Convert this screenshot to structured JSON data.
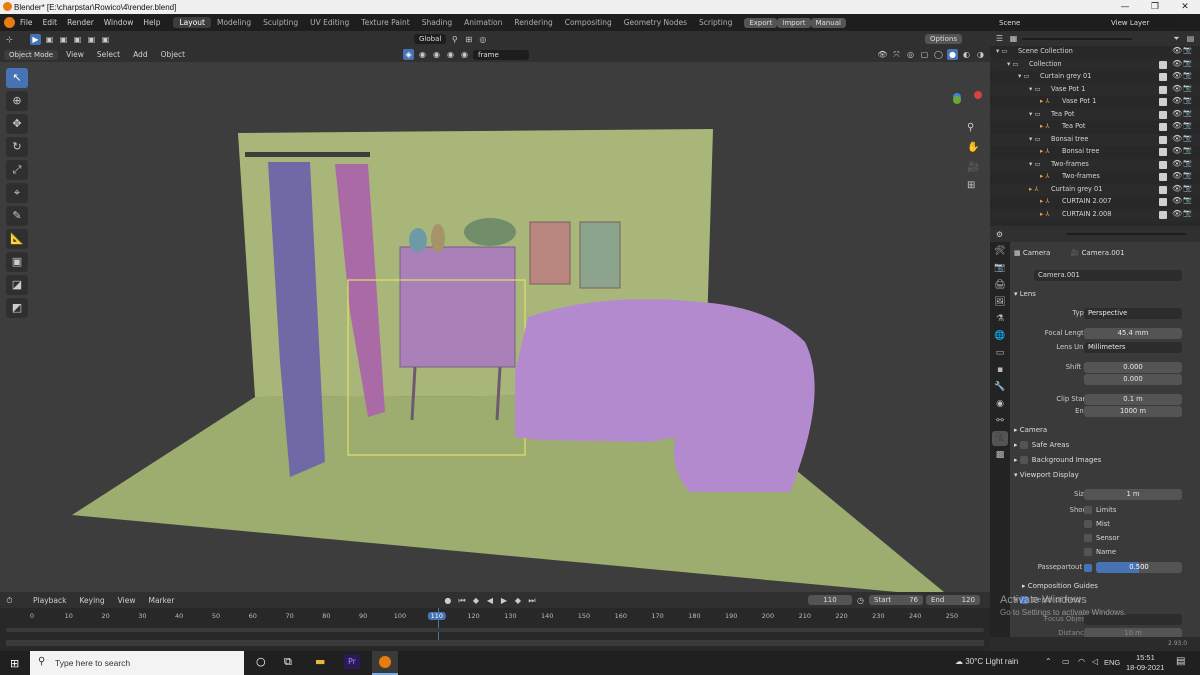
{
  "window": {
    "title": "Blender* [E:\\charpstar\\Rowico\\4\\render.blend]",
    "minimize": "—",
    "maximize": "❐",
    "close": "✕"
  },
  "menu": {
    "items": [
      "File",
      "Edit",
      "Render",
      "Window",
      "Help"
    ],
    "workspaces": [
      "Layout",
      "Modeling",
      "Sculpting",
      "UV Editing",
      "Texture Paint",
      "Shading",
      "Animation",
      "Rendering",
      "Compositing",
      "Geometry Nodes",
      "Scripting"
    ],
    "active_workspace": "Layout",
    "export": "Export",
    "import": "Import",
    "manual": "Manual",
    "scene": "Scene",
    "view_layer": "View Layer"
  },
  "viewport_header": {
    "mode": "Object Mode",
    "menus": [
      "View",
      "Select",
      "Add",
      "Object"
    ],
    "orientation": "Global",
    "search_value": "frame",
    "options": "Options"
  },
  "outliner": {
    "search_placeholder": "",
    "rows": [
      {
        "name": "Scene Collection",
        "indent": 0,
        "kind": "scene"
      },
      {
        "name": "Collection",
        "indent": 1,
        "kind": "collection"
      },
      {
        "name": "Curtain grey 01",
        "indent": 2,
        "kind": "collection"
      },
      {
        "name": "Vase Pot 1",
        "indent": 3,
        "kind": "collection"
      },
      {
        "name": "Vase Pot 1",
        "indent": 4,
        "kind": "object"
      },
      {
        "name": "Tea Pot",
        "indent": 3,
        "kind": "collection"
      },
      {
        "name": "Tea Pot",
        "indent": 4,
        "kind": "object"
      },
      {
        "name": "Bonsai tree",
        "indent": 3,
        "kind": "collection"
      },
      {
        "name": "Bonsai tree",
        "indent": 4,
        "kind": "object"
      },
      {
        "name": "Two-frames",
        "indent": 3,
        "kind": "collection"
      },
      {
        "name": "Two-frames",
        "indent": 4,
        "kind": "object"
      },
      {
        "name": "Curtain grey 01",
        "indent": 3,
        "kind": "object"
      },
      {
        "name": "CURTAIN 2.007",
        "indent": 4,
        "kind": "object"
      },
      {
        "name": "CURTAIN 2.008",
        "indent": 4,
        "kind": "object"
      }
    ]
  },
  "properties": {
    "breadcrumb_obj": "Camera",
    "breadcrumb_data": "Camera.001",
    "datablock": "Camera.001",
    "lens_section": "Lens",
    "type_label": "Type",
    "type_value": "Perspective",
    "focal_label": "Focal Length",
    "focal_value": "45.4 mm",
    "lens_unit_label": "Lens Unit",
    "lens_unit_value": "Millimeters",
    "shift_x_label": "Shift X",
    "shift_x_value": "0.000",
    "shift_y_label": "Y",
    "shift_y_value": "0.000",
    "clip_start_label": "Clip Start",
    "clip_start_value": "0.1 m",
    "clip_end_label": "End",
    "clip_end_value": "1000 m",
    "camera_section": "Camera",
    "safe_areas": "Safe Areas",
    "bg_images": "Background Images",
    "viewport_display": "Viewport Display",
    "size_label": "Size",
    "size_value": "1 m",
    "show_label": "Show",
    "limits": "Limits",
    "mist": "Mist",
    "sensor": "Sensor",
    "name": "Name",
    "passepartout_label": "Passepartout",
    "passepartout_value": "0.500",
    "passepartout_level": 0.5,
    "composition_guides": "Composition Guides",
    "depth_of_field": "Depth of Field",
    "focus_object": "Focus Object",
    "distance": "Distance",
    "distance_value": "10 m"
  },
  "watermark": {
    "line1": "Activate Windows",
    "line2": "Go to Settings to activate Windows."
  },
  "timeline": {
    "menus": [
      "Playback",
      "Keying",
      "View",
      "Marker"
    ],
    "current_frame": "110",
    "start_label": "Start",
    "start_value": "76",
    "end_label": "End",
    "end_value": "120",
    "ticks": [
      "0",
      "10",
      "20",
      "30",
      "40",
      "50",
      "60",
      "70",
      "80",
      "90",
      "100",
      "110",
      "120",
      "130",
      "140",
      "150",
      "160",
      "170",
      "180",
      "190",
      "200",
      "210",
      "220",
      "230",
      "240",
      "250"
    ],
    "version": "2.93.0"
  },
  "taskbar": {
    "search_placeholder": "Type here to search",
    "weather": "30°C  Light rain",
    "lang": "ENG",
    "time": "15:51",
    "date": "18-09-2021"
  }
}
